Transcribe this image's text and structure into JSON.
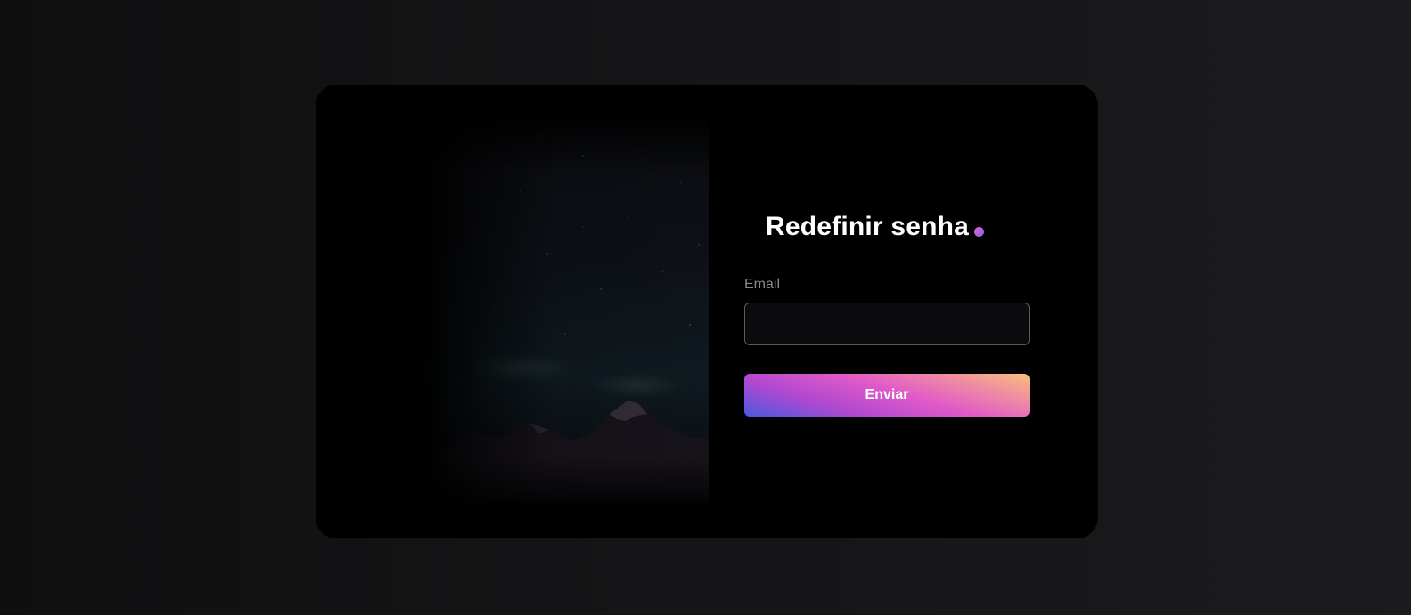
{
  "form": {
    "title": "Redefinir senha",
    "email_label": "Email",
    "email_value": "",
    "submit_label": "Enviar"
  },
  "colors": {
    "page_background": "#151517",
    "card_background": "#000000",
    "title_text": "#ffffff",
    "label_text": "#8a8a8f",
    "input_background": "#0b0b0d",
    "input_border": "#5a5a60",
    "button_gradient": [
      "#4a5ae0",
      "#b048d0",
      "#e05ac8",
      "#f090a0",
      "#f8c07a"
    ],
    "accent_dot": "#c060d8"
  },
  "icons": {
    "title_accent": "gradient-dot-icon",
    "hero_image": "night-sky-mountains-image"
  }
}
